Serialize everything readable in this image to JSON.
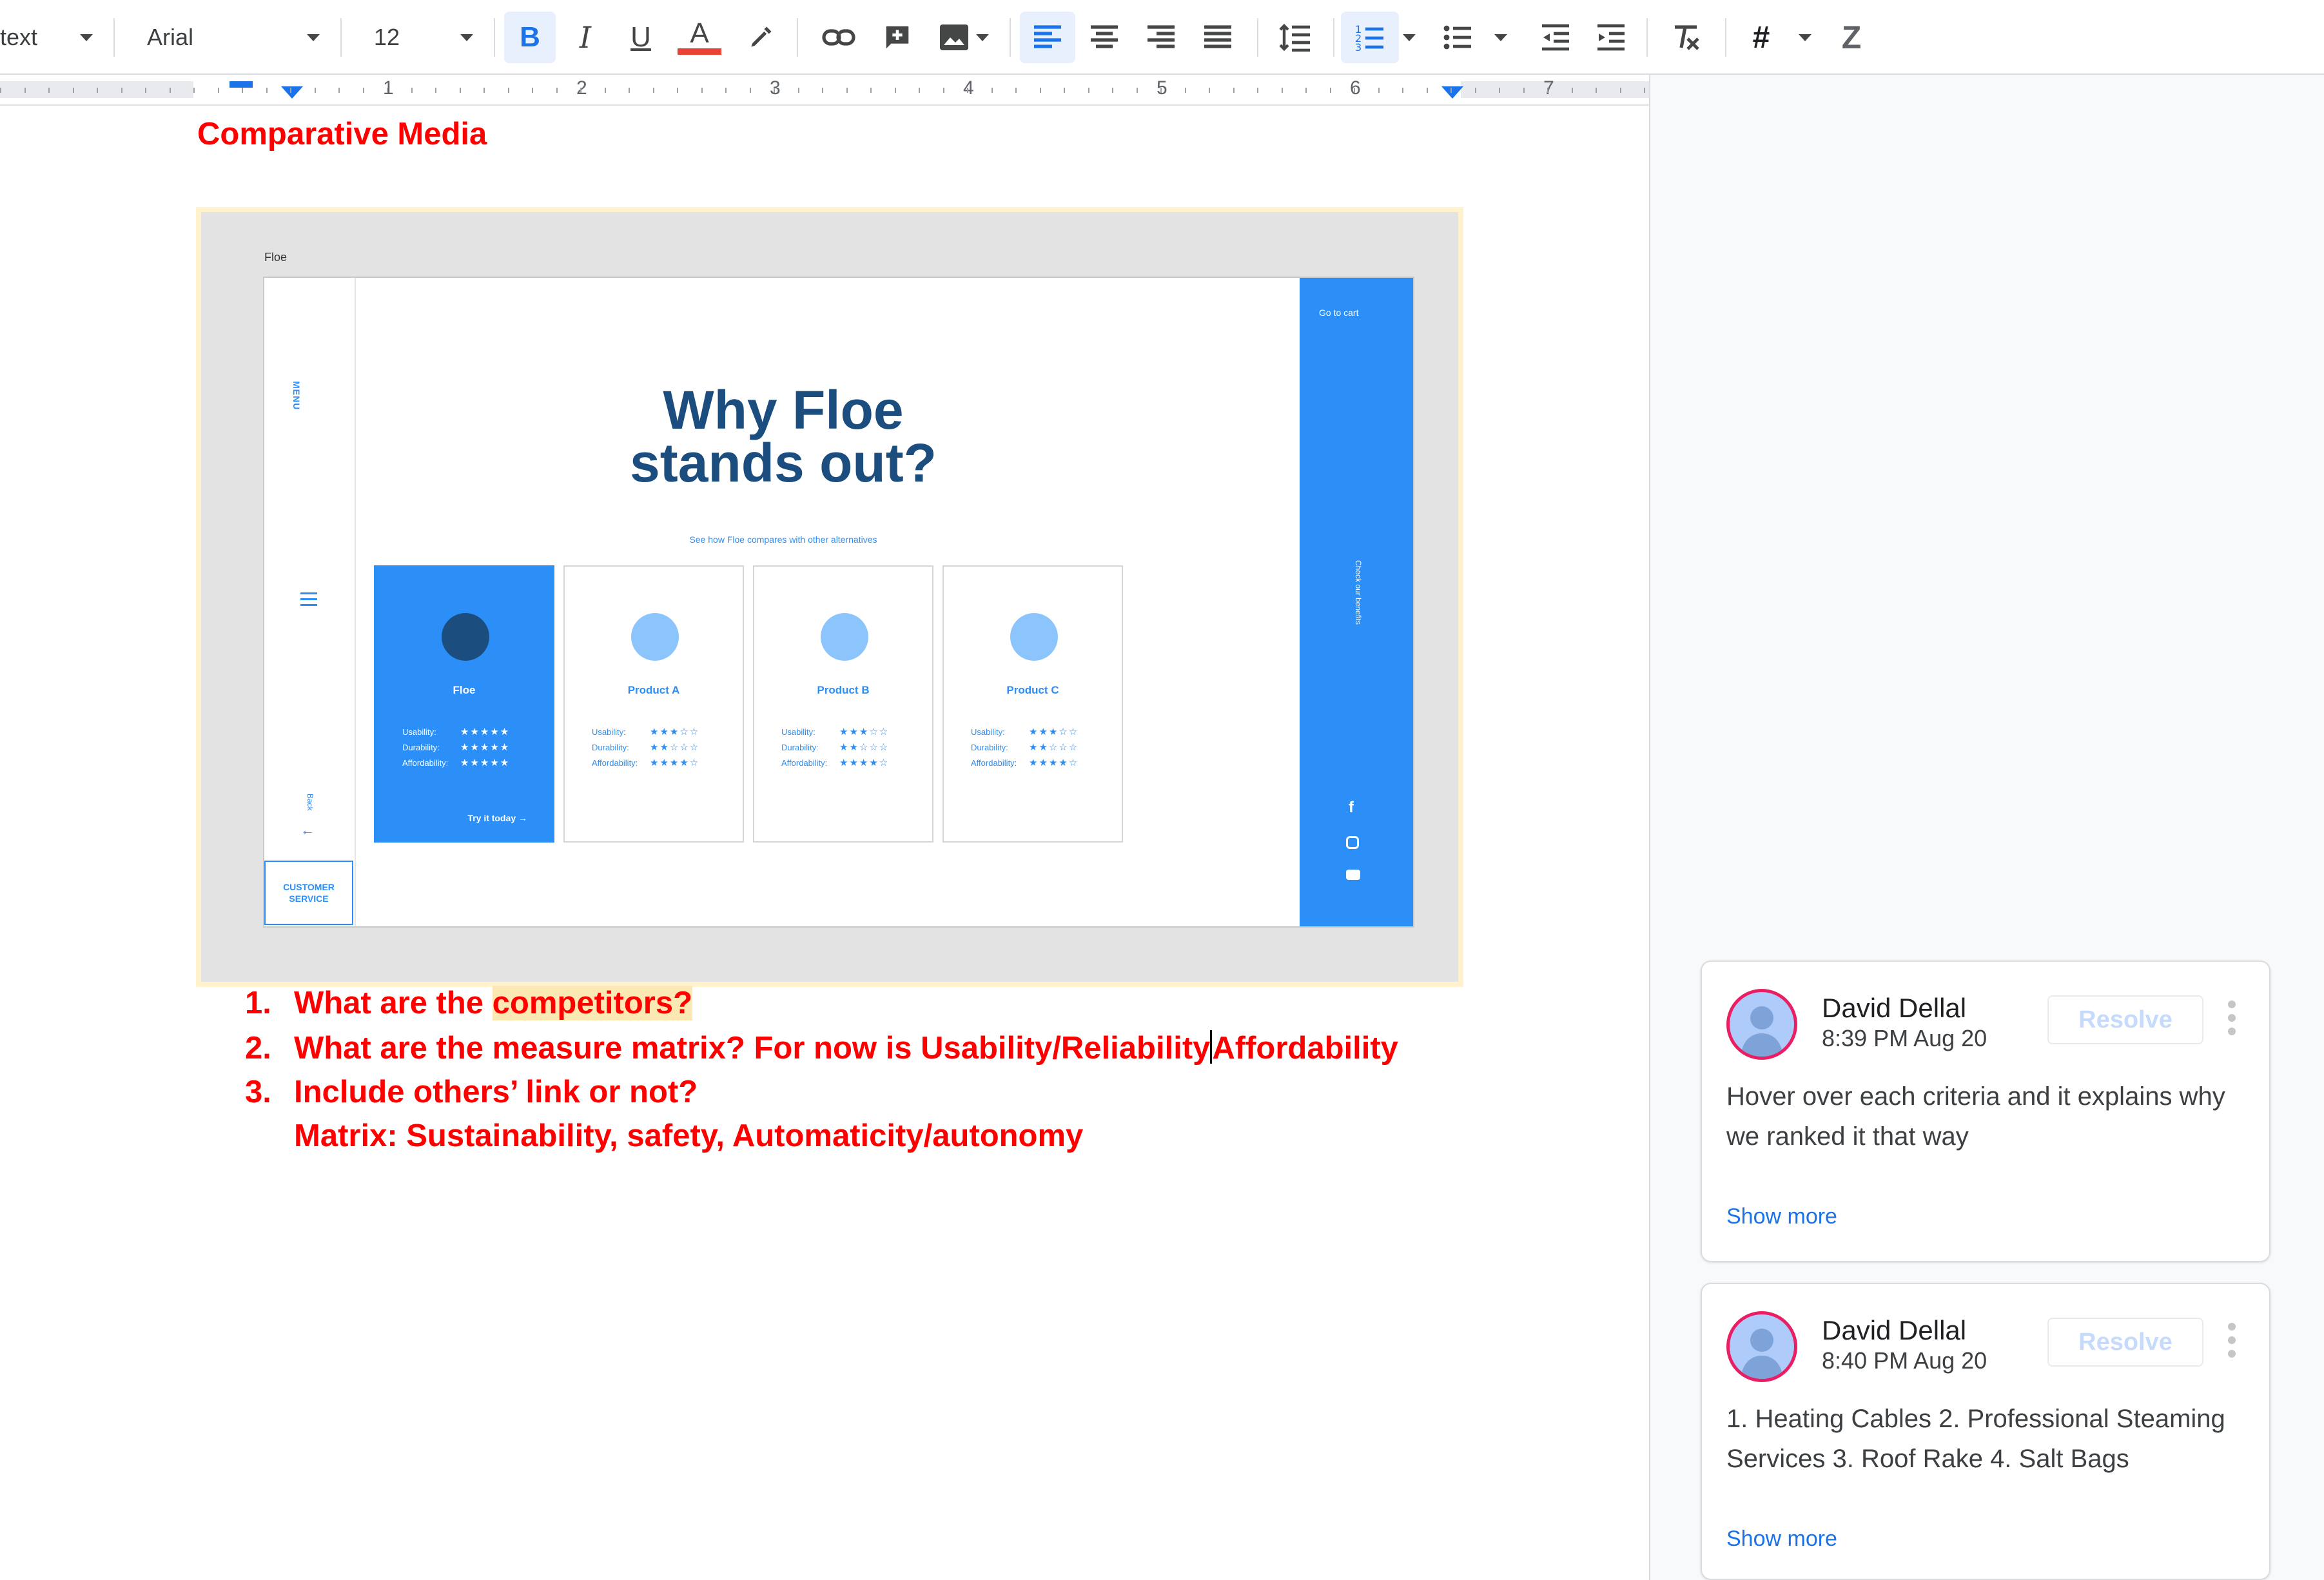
{
  "toolbar": {
    "style_select": "text",
    "font_select": "Arial",
    "size_select": "12",
    "bold_icon": "bold-icon",
    "italic_icon": "italic-icon",
    "underline_icon": "underline-icon",
    "text_color_icon": "text-color-icon",
    "text_color": "#ea4335",
    "highlight_icon": "highlight-icon",
    "link_icon": "link-icon",
    "comment_icon": "add-comment-icon",
    "image_icon": "image-icon"
  },
  "ruler": {
    "numbers": [
      "1",
      "2",
      "3",
      "4",
      "5",
      "6",
      "7"
    ]
  },
  "document": {
    "heading": "Comparative Media",
    "embedded_mock": {
      "window_title": "Floe",
      "go_to_cart": "Go to cart",
      "menu_label": "MENU",
      "back_label": "Back",
      "customer_service": "CUSTOMER SERVICE",
      "side_caption": "Check our benefits",
      "title_line1": "Why Floe",
      "title_line2": "stands out?",
      "subtitle": "See how Floe compares with other alternatives",
      "cards": [
        {
          "name": "Floe",
          "rows": [
            [
              "Usability:",
              "★★★★★"
            ],
            [
              "Durability:",
              "★★★★★"
            ],
            [
              "Affordability:",
              "★★★★★"
            ]
          ],
          "cta": "Try it today"
        },
        {
          "name": "Product A",
          "rows": [
            [
              "Usability:",
              "★★★☆☆"
            ],
            [
              "Durability:",
              "★★☆☆☆"
            ],
            [
              "Affordability:",
              "★★★★☆"
            ]
          ]
        },
        {
          "name": "Product B",
          "rows": [
            [
              "Usability:",
              "★★★☆☆"
            ],
            [
              "Durability:",
              "★★☆☆☆"
            ],
            [
              "Affordability:",
              "★★★★☆"
            ]
          ]
        },
        {
          "name": "Product C",
          "rows": [
            [
              "Usability:",
              "★★★☆☆"
            ],
            [
              "Durability:",
              "★★☆☆☆"
            ],
            [
              "Affordability:",
              "★★★★☆"
            ]
          ]
        }
      ]
    },
    "list": [
      {
        "num": "1.",
        "pre": "What are the ",
        "highlight": "competitors?"
      },
      {
        "num": "2.",
        "pre": "What are the measure matrix? For now is Usability/Reliability",
        "post": "Affordability"
      },
      {
        "num": "3.",
        "text": "Include others’ link or not?"
      }
    ],
    "extra_line": "Matrix: Sustainability, safety, Automaticity/autonomy"
  },
  "comments": [
    {
      "author": "David Dellal",
      "time": "8:39 PM Aug 20",
      "resolve": "Resolve",
      "body": "Hover over each criteria and it explains why we ranked it that way",
      "show_more": "Show more"
    },
    {
      "author": "David Dellal",
      "time": "8:40 PM Aug 20",
      "resolve": "Resolve",
      "body": "1. Heating Cables 2. Professional Steaming Services 3. Roof Rake 4. Salt Bags",
      "show_more": "Show more"
    }
  ]
}
